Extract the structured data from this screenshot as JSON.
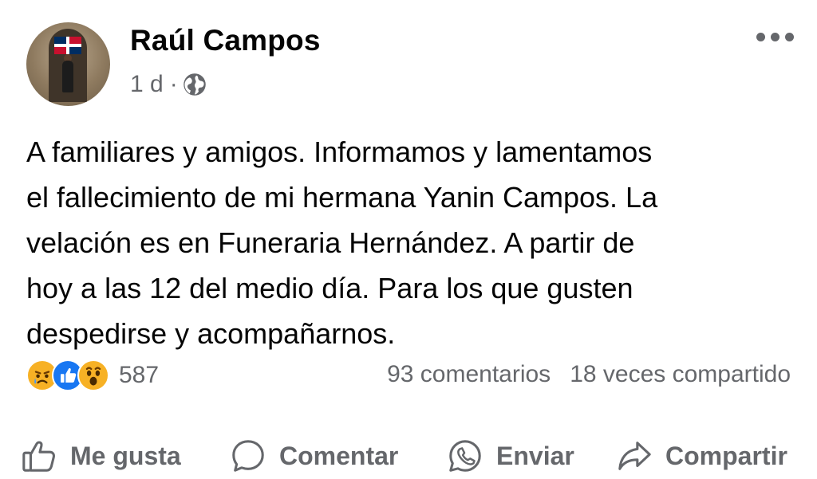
{
  "post": {
    "author": "Raúl Campos",
    "time": "1 d",
    "meta_separator": "·",
    "privacy_icon": "globe-icon",
    "more_icon": "more-options-icon",
    "text": "A familiares y amigos. Informamos y lamentamos\nel fallecimiento de mi hermana Yanin Campos. La\nvelación  es en Funeraria Hernández. A partir de\nhoy a las 12 del medio día. Para los que gusten\ndespedirse y acompañarnos."
  },
  "stats": {
    "reactions": [
      "sad-icon",
      "like-icon",
      "wow-icon"
    ],
    "reaction_count": "587",
    "comments": "93 comentarios",
    "shares": "18 veces compartido"
  },
  "actions": {
    "like": "Me gusta",
    "comment": "Comentar",
    "send": "Enviar",
    "share": "Compartir"
  },
  "colors": {
    "text": "#050505",
    "secondary": "#65676b",
    "like_blue": "#1877f2",
    "emoji_yellow": "#f7b125"
  }
}
